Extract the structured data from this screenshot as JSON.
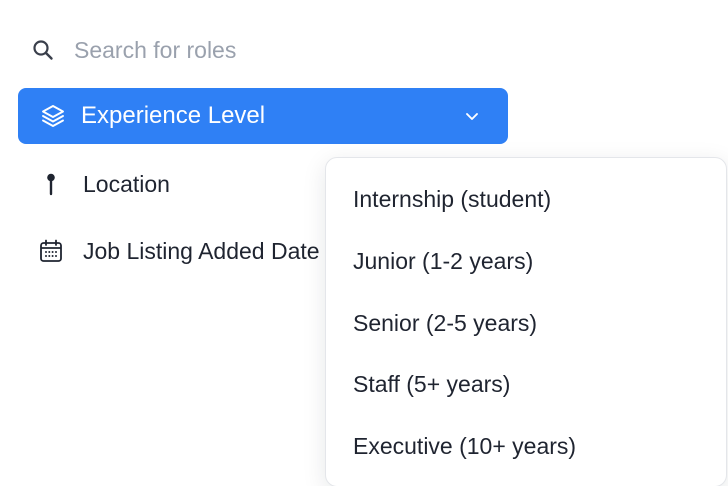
{
  "search": {
    "icon": "search-icon",
    "placeholder": "Search for roles",
    "value": ""
  },
  "filters": {
    "experience": {
      "label": "Experience Level",
      "icon": "layers-icon",
      "expanded": true,
      "active_color": "#2f80f5"
    },
    "location": {
      "label": "Location",
      "icon": "pin-icon"
    },
    "date_added": {
      "label": "Job Listing Added Date",
      "icon": "calendar-icon"
    }
  },
  "dropdown": {
    "options": [
      {
        "label": "Internship (student)"
      },
      {
        "label": "Junior (1-2 years)"
      },
      {
        "label": "Senior (2-5 years)"
      },
      {
        "label": "Staff (5+ years)"
      },
      {
        "label": "Executive (10+ years)"
      }
    ]
  }
}
